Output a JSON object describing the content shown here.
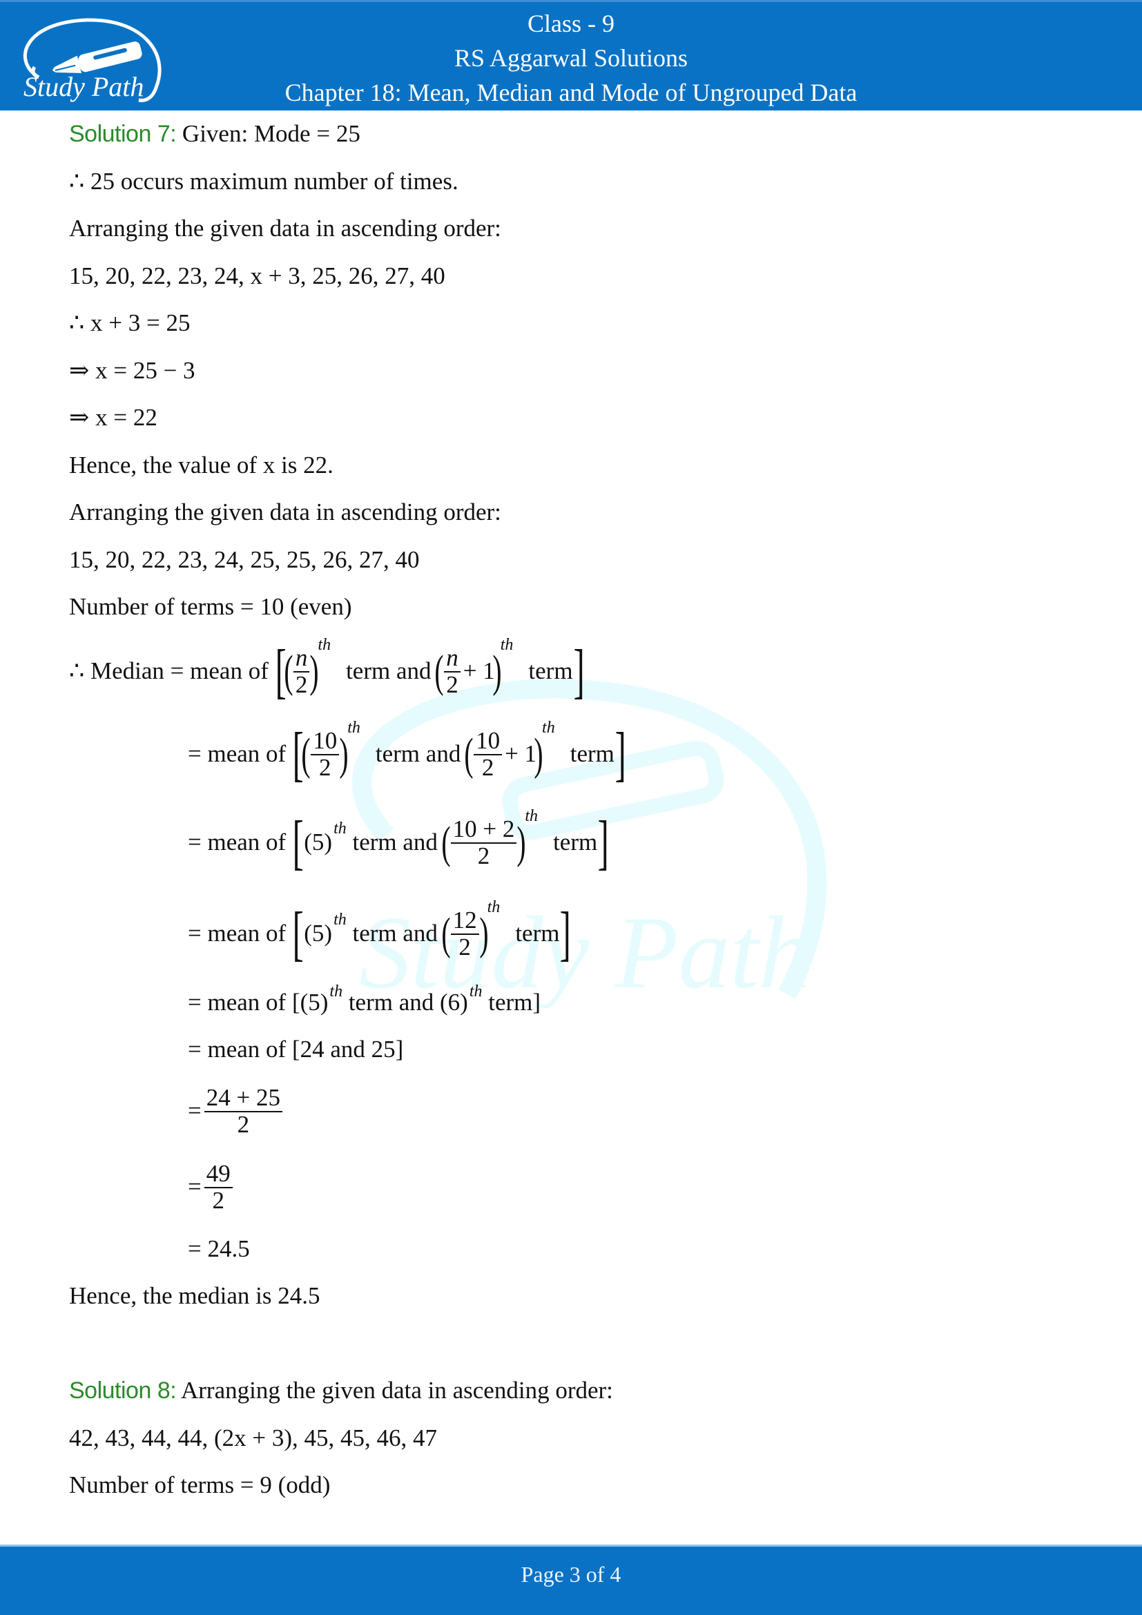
{
  "header": {
    "logo_text": "Study Path",
    "line1": "Class - 9",
    "line2": "RS Aggarwal Solutions",
    "line3": "Chapter 18: Mean, Median and Mode of Ungrouped Data"
  },
  "solution7": {
    "label": "Solution 7:",
    "given": " Given: Mode = 25",
    "l1": "∴ 25 occurs maximum number of times.",
    "l2": "Arranging the given data in ascending order:",
    "l3": "15, 20, 22, 23, 24, x + 3, 25, 26, 27, 40",
    "l4": "∴ x + 3 = 25",
    "l5": "⇒ x = 25 − 3",
    "l6": "⇒ x = 22",
    "l7": "Hence, the value of x is 22.",
    "l8": "Arranging the given data in ascending order:",
    "l9": "15, 20, 22, 23, 24, 25, 25, 26, 27, 40",
    "l10": "Number of terms = 10 (even)",
    "median_prefix": "∴ Median = mean of",
    "eq_mean_of": "= mean of",
    "term": "term",
    "term_and": "term and",
    "th": "th",
    "n": "n",
    "two": "2",
    "ten": "10",
    "plus_one": "+ 1",
    "five_paren": "(5)",
    "ten_plus_two": "10 + 2",
    "twelve": "12",
    "l_step5": "= mean of [(5)",
    "l_step5b": " term and (6)",
    "l_step5c": " term]",
    "l_step6": "= mean of [24 and 25]",
    "frac1_num": "24 + 25",
    "frac2_num": "49",
    "eq": "=",
    "result": "= 24.5",
    "conclusion": "Hence, the median is 24.5"
  },
  "solution8": {
    "label": "Solution 8:",
    "l1": " Arranging the given data in ascending order:",
    "l2": "42, 43, 44, 44, (2x + 3), 45, 45, 46, 47",
    "l3": "Number of terms = 9 (odd)"
  },
  "footer": {
    "page_label": "Page 3 of 4"
  }
}
